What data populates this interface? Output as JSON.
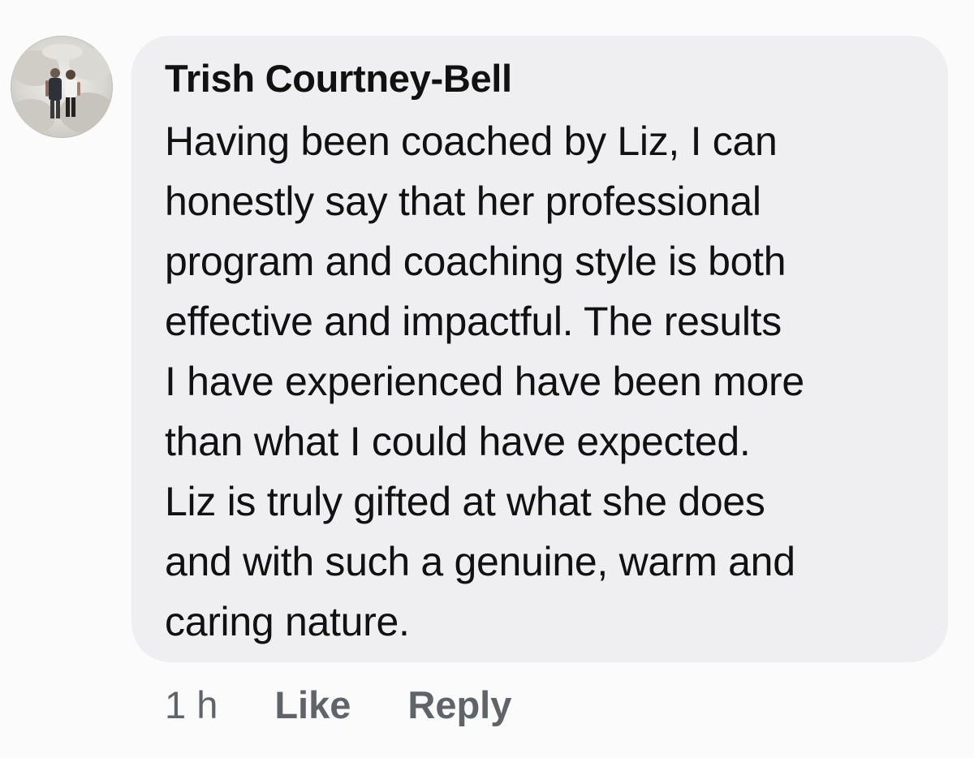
{
  "comment": {
    "author": "Trish Courtney-Bell",
    "text_lines": [
      "Having been coached by Liz, I can",
      "honestly say that her professional",
      "program and coaching style is both",
      "effective and impactful. The results",
      "I have experienced have been more",
      "than what I could have expected.",
      "Liz is truly gifted at what she does",
      "and with such a genuine, warm and",
      "caring nature."
    ],
    "timestamp": "1 h",
    "like_label": "Like",
    "reply_label": "Reply"
  },
  "colors": {
    "page_background": "#fbfbfb",
    "bubble_background": "#efeff1",
    "text": "#111111",
    "secondary_text": "#606368"
  },
  "icons": {
    "avatar": "profile-photo-two-people"
  }
}
